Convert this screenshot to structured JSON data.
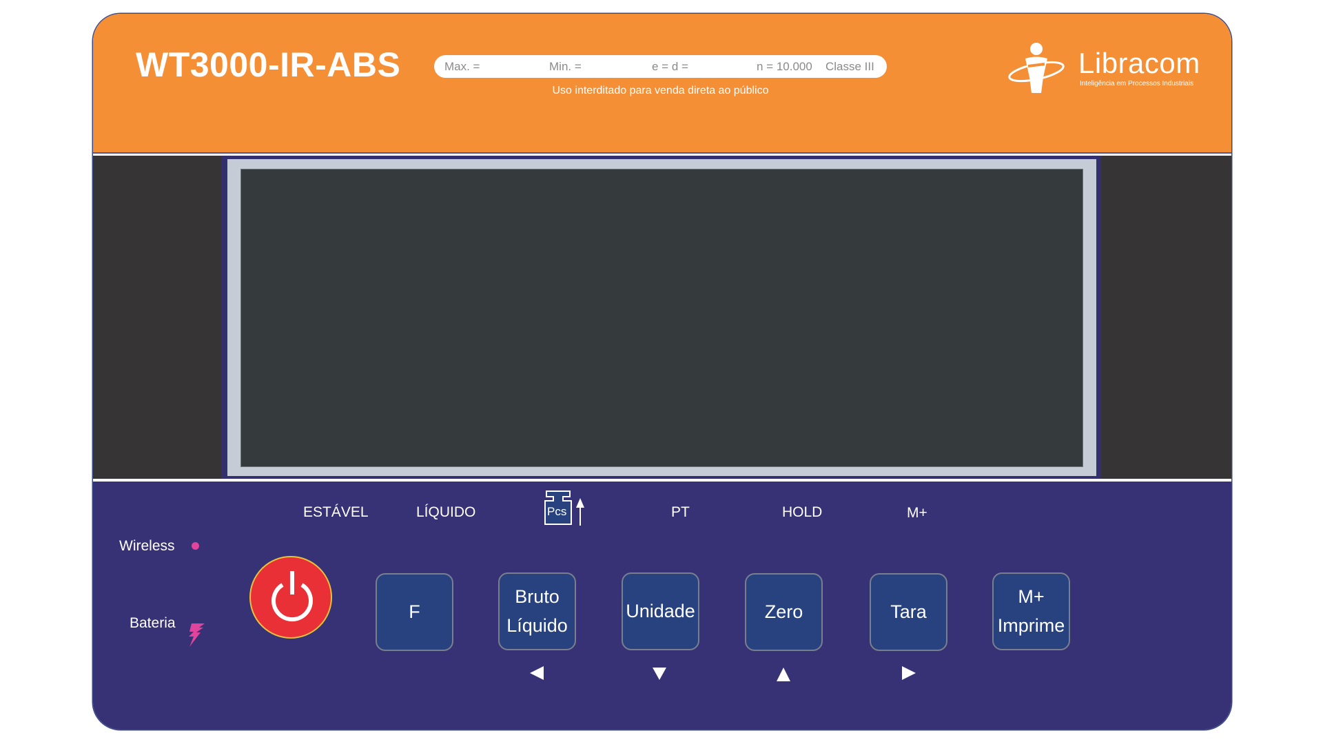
{
  "header": {
    "model": "WT3000-IR-ABS",
    "specs": {
      "max": "Max. =",
      "min": "Min. =",
      "e_d": "e = d =",
      "n": "n = 10.000",
      "class": "Classe III"
    },
    "note": "Uso interditado para venda direta ao público",
    "logo": {
      "name": "Libracom",
      "tagline": "Inteligência em Processos Industriais",
      "icon": "person-orbit-logo-icon"
    }
  },
  "colors": {
    "header": "#f58f35",
    "keypad": "#363275",
    "key": "#27427f",
    "power": "#ea3037",
    "indicator_accent": "#e0449c",
    "display_bezel": "#c6ccd6",
    "display_screen": "#353a3d"
  },
  "display": {
    "reading": ""
  },
  "status_labels": {
    "stable": "ESTÁVEL",
    "net": "LÍQUIDO",
    "pcs": "Pcs",
    "pt": "PT",
    "hold": "HOLD",
    "m_plus": "M+"
  },
  "indicators": {
    "wireless": "Wireless",
    "battery": "Bateria"
  },
  "keys": {
    "power": "power-icon",
    "f": {
      "lines": [
        "F"
      ]
    },
    "bruto_liquido": {
      "lines": [
        "Bruto",
        "Líquido"
      ],
      "arrow": "◀"
    },
    "unidade": {
      "lines": [
        "Unidade"
      ],
      "arrow": "▼"
    },
    "zero": {
      "lines": [
        "Zero"
      ],
      "arrow": "▲"
    },
    "tara": {
      "lines": [
        "Tara"
      ],
      "arrow": "▶"
    },
    "m_imprime": {
      "lines": [
        "M+",
        "Imprime"
      ]
    }
  }
}
